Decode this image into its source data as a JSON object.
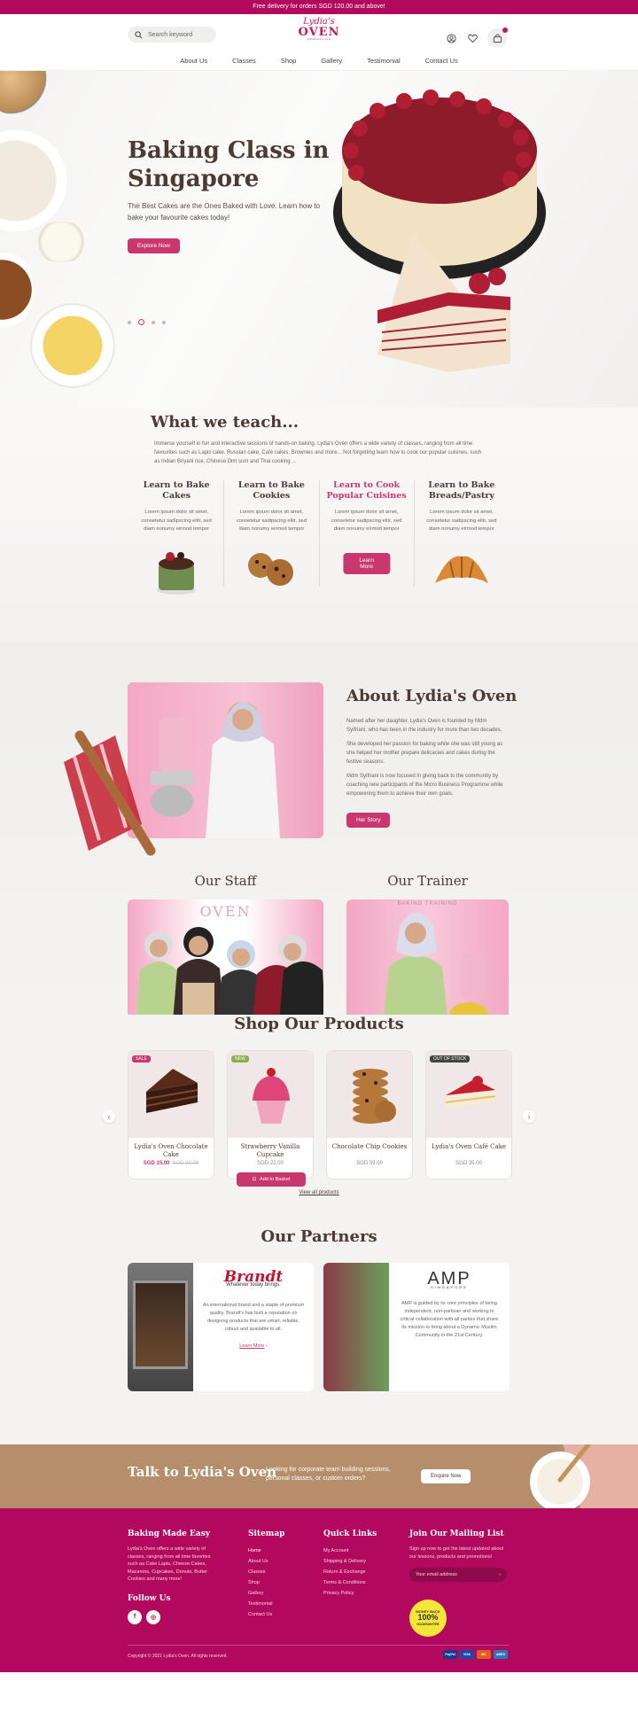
{
  "topbar": {
    "text": "Free delivery for orders SGD 120.00 and above!"
  },
  "header": {
    "search_placeholder": "Search keyword",
    "logo": {
      "line1": "Lydia's",
      "line2": "OVEN",
      "line3": "lydiasoven.com"
    },
    "icons": [
      "user-icon",
      "heart-icon",
      "cart-icon"
    ]
  },
  "nav": {
    "items": [
      "About Us",
      "Classes",
      "Shop",
      "Gallery",
      "Testimonial",
      "Contact Us"
    ]
  },
  "hero": {
    "title": "Baking Class in Singapore",
    "subtitle": "The Best Cakes are the Ones Baked with Love. Learn how to bake your favourite cakes today!",
    "cta": "Explore Now"
  },
  "teach": {
    "title": "What we teach...",
    "description": "Immerse yourself in fun and interactive sessions of hands-on baking. Lydia's Oven offers a wide variety of classes, ranging from all time favourites such as Lapis cake, Russian cake, Café cakes, Brownies and more... Not forgetting learn how to cook our popular cuisines, such as Indian Briyani rice, Chinese Dim sum and Thai cooking ...",
    "columns": [
      {
        "title": "Learn to Bake Cakes",
        "text": "Lorem ipsum dolor sit amet, consetetur sadipscing elitr, sed diam nonumy eirmod tempor"
      },
      {
        "title": "Learn to Bake Cookies",
        "text": "Lorem ipsum dolor sit amet, consetetur sadipscing elitr, sed diam nonumy eirmod tempor"
      },
      {
        "title": "Learn to Cook Popular Cuisines",
        "text": "Lorem ipsum dolor sit amet, consetetur sadipscing elitr, sed diam nonumy eirmod tempor",
        "button": "Learn More"
      },
      {
        "title": "Learn to Bake Breads/Pastry",
        "text": "Lorem ipsum dolor sit amet, consetetur sadipscing elitr, sed diam nonumy eirmod tempor"
      }
    ]
  },
  "about": {
    "title": "About Lydia's Oven",
    "paragraphs": [
      "Named after her daughter, Lydia's Oven is founded by Mdm Syifriani, who has been in the industry for more than two decades.",
      "She developed her passion for baking while she was still young as she helped her mother prepare delicacies and cakes during the festive seasons.",
      "Mdm Syifriani is now focused in giving back to the community by coaching new participants of the Micro Business Programme while empowering them to achieve their own goals."
    ],
    "button": "Her Story",
    "staff_title": "Our Staff",
    "trainer_title": "Our Trainer",
    "backdrop_text": "OVEN",
    "trainer_backdrop_text": "BAKING TRAINING"
  },
  "shop": {
    "title": "Shop Our Products",
    "products": [
      {
        "tag": "SALE",
        "tag_color": "#c8386e",
        "name": "Lydia's Oven Chocolate Cake",
        "price": "SGD 15.00",
        "old_price": "SGD 20.00"
      },
      {
        "tag": "NEW",
        "tag_color": "#8bb04a",
        "name": "Strawberry Vanilla Cupcake",
        "price": "SGD 22.00",
        "button": "Add to Basket"
      },
      {
        "tag": "",
        "tag_color": "",
        "name": "Chocolate Chip Cookies",
        "price": "SGD 59.00"
      },
      {
        "tag": "OUT OF STOCK",
        "tag_color": "#444444",
        "name": "Lydia's Oven Café Cake",
        "price": "SGD 35.00"
      }
    ],
    "view_all": "View all products"
  },
  "partners": {
    "title": "Our Partners",
    "items": [
      {
        "brand": "Brandt",
        "tagline": "Whatever today brings.",
        "text": "An international brand and a staple of premium quality, Brandt's has built a reputation on designing products that are smart, reliable, robust and available to all.",
        "link": "Learn More"
      },
      {
        "brand": "AMP",
        "tagline": "SINGAPORE",
        "text": "AMP is guided by its core principles of being independent, non-partisan and working in critical collaboration with all parties that share its mission to bring about a Dynamic Muslim Community in the 21st Century."
      }
    ]
  },
  "talk": {
    "title": "Talk to Lydia's Oven",
    "text": "Looking for corporate team building sessions, personal classes, or custom orders?",
    "button": "Enquire Now"
  },
  "footer": {
    "about_title": "Baking Made Easy",
    "about_text": "Lydia's Oven offers a wide variety of classes, ranging from all time favorites such as Cake Lapis, Cheese Cakes, Macarons, Cupcakes, Donuts, Butter Cookies and many more!",
    "follow_title": "Follow Us",
    "sitemap_title": "Sitemap",
    "sitemap": [
      "Home",
      "About Us",
      "Classes",
      "Shop",
      "Gallery",
      "Testimonial",
      "Contact Us"
    ],
    "quick_title": "Quick Links",
    "quick": [
      "My Account",
      "Shipping & Delivery",
      "Return & Exchange",
      "Terms & Conditions",
      "Privacy Policy"
    ],
    "mailing_title": "Join Our Mailing List",
    "mailing_text": "Sign up now to get the latest updated about our lessons, products and promotions!",
    "email_placeholder": "Your email address",
    "seal": {
      "line1": "MONEY BACK",
      "pct": "100%",
      "line2": "GUARANTEE"
    },
    "copyright": "Copyright © 2021 Lydia's Oven. All rights reserved.",
    "payments": [
      "PayPal",
      "VISA",
      "MC",
      "AMEX"
    ]
  },
  "colors": {
    "brand": "#b2095f",
    "accent": "#c8386e",
    "heading": "#4c3a34",
    "talk_bg": "#b58f6b"
  }
}
